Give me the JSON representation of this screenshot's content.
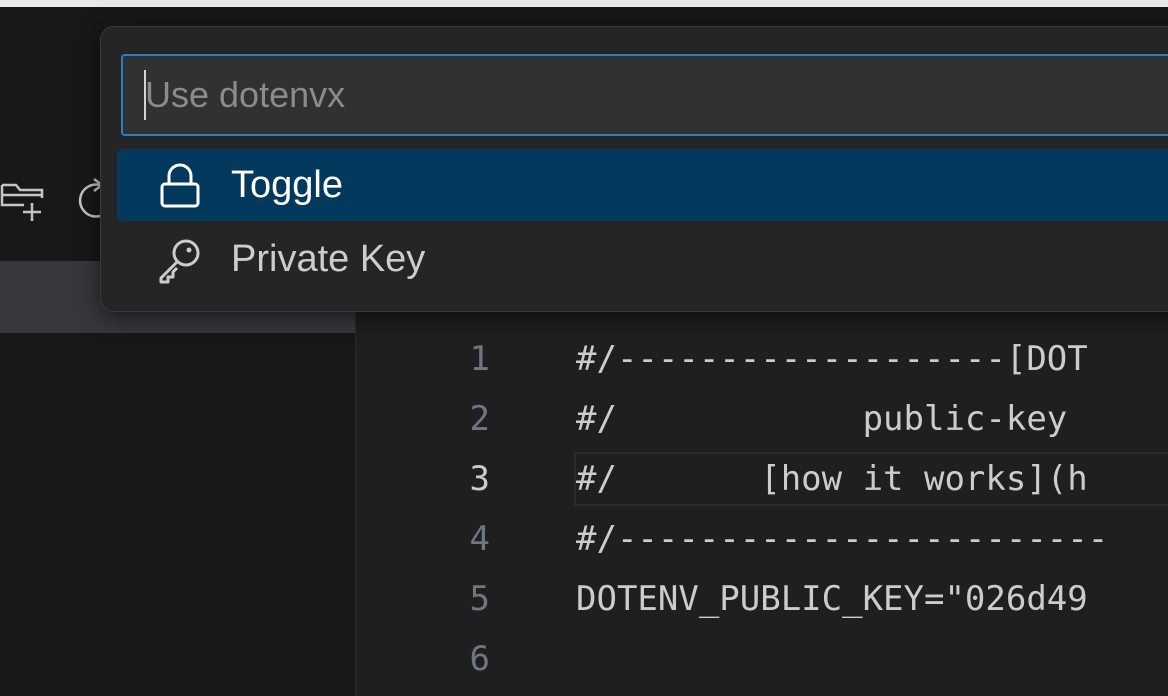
{
  "command_palette": {
    "placeholder": "Use dotenvx",
    "value": "",
    "items": [
      {
        "label": "Toggle",
        "icon": "lock-icon",
        "selected": true
      },
      {
        "label": "Private Key",
        "icon": "key-icon",
        "selected": false
      }
    ]
  },
  "editor": {
    "active_line": 3,
    "lines": [
      {
        "number": "1",
        "text": "#/-------------------[DOT"
      },
      {
        "number": "2",
        "text": "#/            public-key"
      },
      {
        "number": "3",
        "text": "#/       [how it works](h"
      },
      {
        "number": "4",
        "text": "#/------------------------"
      },
      {
        "number": "5",
        "text": "DOTENV_PUBLIC_KEY=\"026d49"
      },
      {
        "number": "6",
        "text": ""
      }
    ]
  },
  "colors": {
    "accent": "#2a7fc4",
    "selection": "#04395e",
    "background": "#1f1f1f"
  }
}
